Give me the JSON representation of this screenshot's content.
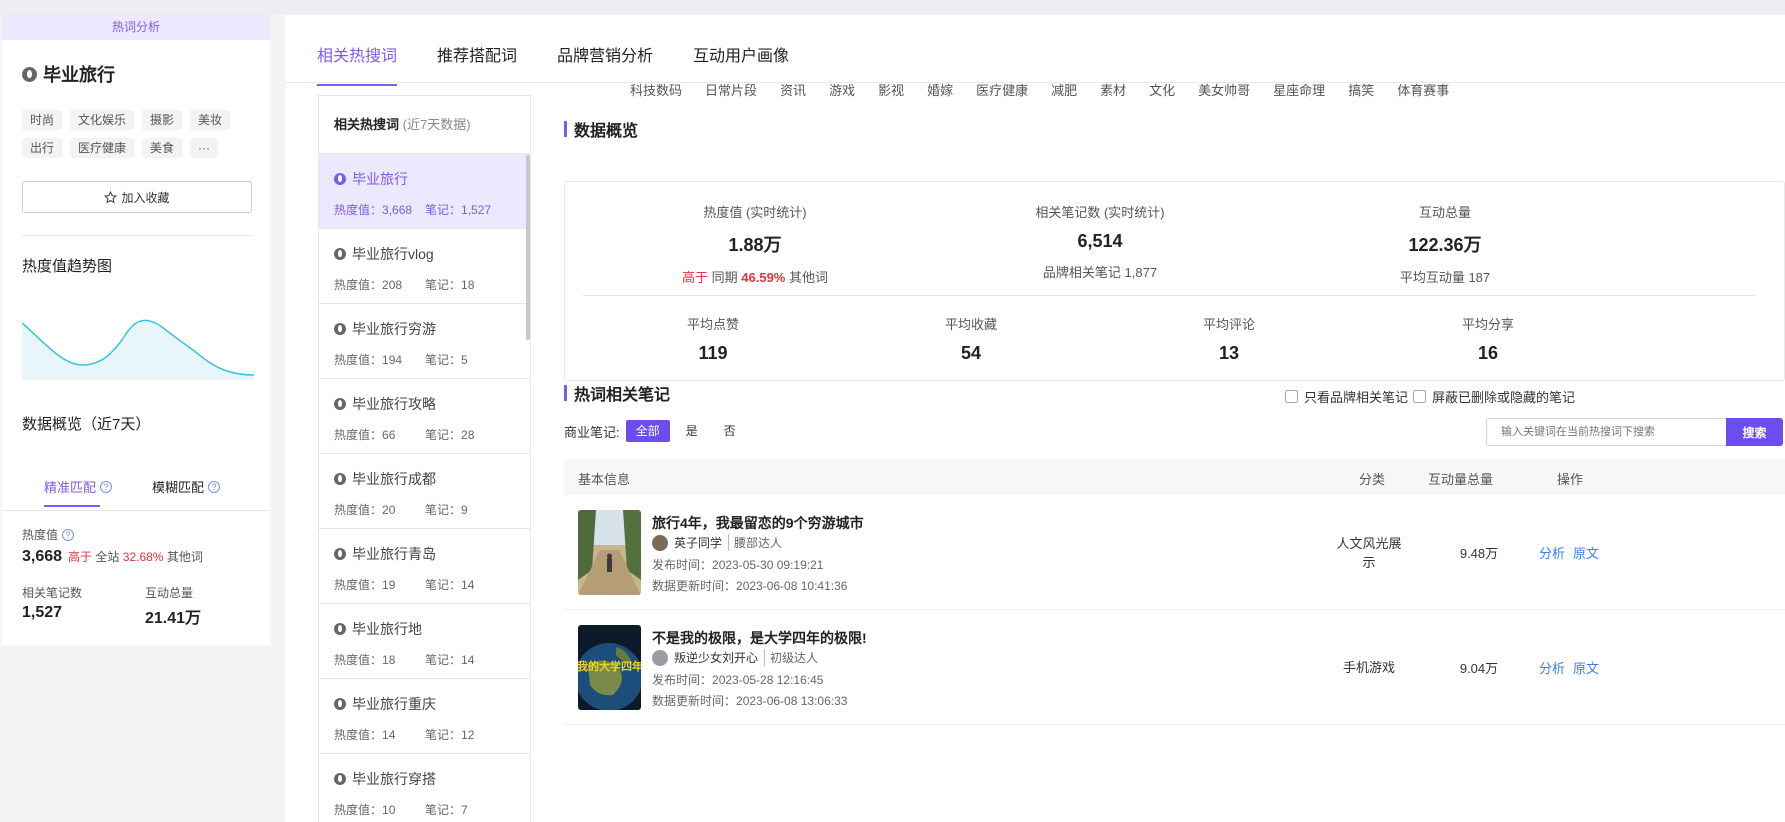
{
  "left": {
    "banner": "热词分析",
    "keyword": "毕业旅行",
    "tags": [
      "时尚",
      "文化娱乐",
      "摄影",
      "美妆",
      "出行",
      "医疗健康",
      "美食",
      "···"
    ],
    "favorite_label": "加入收藏",
    "trend_title": "热度值趋势图",
    "overview_title": "数据概览（近7天）",
    "match_tabs": [
      "精准匹配",
      "模糊匹配"
    ],
    "heat_label": "热度值",
    "heat_value": "3,668",
    "heat_compare_prefix": "高于",
    "heat_compare_scope": "全站",
    "heat_compare_pct": "32.68%",
    "heat_compare_suffix": "其他词",
    "notes_label": "相关笔记数",
    "notes_value": "1,527",
    "interact_label": "互动总量",
    "interact_value": "21.41万",
    "colors": {
      "accent": "#7b5cf0",
      "trend_line": "#36c5e0"
    }
  },
  "main": {
    "tabs": [
      "相关热搜词",
      "推荐搭配词",
      "品牌营销分析",
      "互动用户画像"
    ],
    "categories": [
      "科技数码",
      "日常片段",
      "资讯",
      "游戏",
      "影视",
      "婚嫁",
      "医疗健康",
      "减肥",
      "素材",
      "文化",
      "美女帅哥",
      "星座命理",
      "搞笑",
      "体育赛事"
    ],
    "keyword_panel": {
      "title": "相关热搜词",
      "subtitle": "(近7天数据)",
      "heat_prefix": "热度值：",
      "notes_prefix": "笔记：",
      "items": [
        {
          "name": "毕业旅行",
          "heat": "3,668",
          "notes": "1,527"
        },
        {
          "name": "毕业旅行vlog",
          "heat": "208",
          "notes": "18"
        },
        {
          "name": "毕业旅行穷游",
          "heat": "194",
          "notes": "5"
        },
        {
          "name": "毕业旅行攻略",
          "heat": "66",
          "notes": "28"
        },
        {
          "name": "毕业旅行成都",
          "heat": "20",
          "notes": "9"
        },
        {
          "name": "毕业旅行青岛",
          "heat": "19",
          "notes": "14"
        },
        {
          "name": "毕业旅行地",
          "heat": "18",
          "notes": "14"
        },
        {
          "name": "毕业旅行重庆",
          "heat": "14",
          "notes": "12"
        },
        {
          "name": "毕业旅行穿搭",
          "heat": "10",
          "notes": "7"
        }
      ]
    },
    "overview": {
      "title": "数据概览",
      "heat_label": "热度值 (实时统计)",
      "heat_value": "1.88万",
      "heat_cmp_prefix": "高于",
      "heat_cmp_scope": "同期",
      "heat_cmp_pct": "46.59%",
      "heat_cmp_suffix": "其他词",
      "notes_label": "相关笔记数 (实时统计)",
      "notes_value": "6,514",
      "notes_sub": "品牌相关笔记 1,877",
      "interact_label": "互动总量",
      "interact_value": "122.36万",
      "interact_sub": "平均互动量 187",
      "avg": [
        {
          "label": "平均点赞",
          "value": "119"
        },
        {
          "label": "平均收藏",
          "value": "54"
        },
        {
          "label": "平均评论",
          "value": "13"
        },
        {
          "label": "平均分享",
          "value": "16"
        }
      ]
    },
    "notes_section": {
      "title": "热词相关笔记",
      "checkbox_brand": "只看品牌相关笔记",
      "checkbox_hide": "屏蔽已删除或隐藏的笔记",
      "filter_label": "商业笔记:",
      "filter_options": [
        "全部",
        "是",
        "否"
      ],
      "search_placeholder": "输入关键词在当前热搜词下搜索",
      "search_button": "搜索",
      "columns": [
        "基本信息",
        "分类",
        "互动量总量",
        "操作"
      ],
      "rows": [
        {
          "title": "旅行4年，我最留恋的9个穷游城市",
          "author": "英子同学",
          "level": "腰部达人",
          "publish_label": "发布时间：",
          "publish": "2023-05-30 09:19:21",
          "update_label": "数据更新时间：",
          "update": "2023-06-08 10:41:36",
          "category": "人文风光展示",
          "interactions": "9.48万",
          "actions": [
            "分析",
            "原文"
          ]
        },
        {
          "title": "不是我的极限，是大学四年的极限!",
          "author": "叛逆少女刘开心",
          "level": "初级达人",
          "publish_label": "发布时间：",
          "publish": "2023-05-28 12:16:45",
          "update_label": "数据更新时间：",
          "update": "2023-06-08 13:06:33",
          "category": "手机游戏",
          "interactions": "9.04万",
          "actions": [
            "分析",
            "原文"
          ],
          "thumb_text": "我的大学四年"
        }
      ]
    }
  }
}
